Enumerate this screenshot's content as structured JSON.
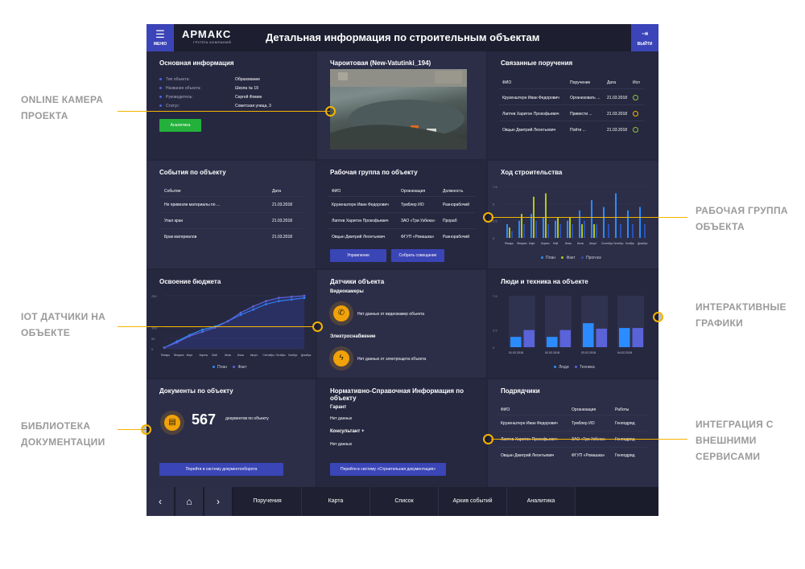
{
  "callouts": {
    "camera": [
      "ONLINE КАМЕРА",
      "ПРОЕКТА"
    ],
    "workgroup": [
      "РАБОЧАЯ ГРУППА",
      "ОБЪЕКТА"
    ],
    "iot": [
      "IOT ДАТЧИКИ НА",
      "ОБЪЕКТЕ"
    ],
    "charts": [
      "ИНТЕРАКТИВНЫЕ",
      "ГРАФИКИ"
    ],
    "docs": [
      "БИБЛИОТЕКА",
      "ДОКУМЕНТАЦИИ"
    ],
    "integration": [
      "ИНТЕГРАЦИЯ С",
      "ВНЕШНИМИ",
      "СЕРВИСАМИ"
    ]
  },
  "topbar": {
    "menu": "МЕНЮ",
    "logo": "АРМАКС",
    "logo_sub": "ГРУППА КОМПАНИЙ",
    "title": "Детальная информация по строительным объектам",
    "exit": "ВЫЙТИ"
  },
  "info": {
    "title": "Основная информация",
    "rows": [
      {
        "k": "Тип объекта:",
        "v": "Образование"
      },
      {
        "k": "Название объекта:",
        "v": "Школа № 19"
      },
      {
        "k": "Руководитель:",
        "v": "Сергей Фомин"
      },
      {
        "k": "Статус:",
        "v": "Советская улица, 3"
      }
    ],
    "button": "Аналитика"
  },
  "camera": {
    "title": "Чароитовая (New-Vatutinki_194)"
  },
  "orders": {
    "title": "Связанные поручения",
    "headers": [
      "ФИО",
      "Поручение",
      "Дата",
      "Исп"
    ],
    "rows": [
      [
        "Крузенштерн Иван Федорович",
        "Организовать ...",
        "21.03.2018"
      ],
      [
        "Лаптев Харитон Прокофьевич",
        "Привести ...",
        "21.03.2018"
      ],
      [
        "Овцын Дмитрий Леонтьевич",
        "Пойти ...",
        "21.03.2018"
      ]
    ]
  },
  "events": {
    "title": "События по объекту",
    "headers": [
      "Событие",
      "Дата"
    ],
    "rows": [
      [
        "Не привезли материалы по ...",
        "21.03.2018"
      ],
      [
        "Упал кран",
        "21.03.2018"
      ],
      [
        "Брак материалов",
        "21.03.2018"
      ]
    ]
  },
  "team": {
    "title": "Рабочая группа по объекту",
    "headers": [
      "ФИО",
      "Организация",
      "Должность"
    ],
    "rows": [
      [
        "Крузенштерн Иван Федорович",
        "Тумблер ИО",
        "Разнорабочий"
      ],
      [
        "Лаптев Харитон Прокофьевич",
        "ЗАО «Три Узбека»",
        "Прораб"
      ],
      [
        "Овцын Дмитрий Леонтьевич",
        "ФГУП «Ромашка»",
        "Разнорабочий"
      ]
    ],
    "btn1": "Управление",
    "btn2": "Собрать совещание"
  },
  "progress": {
    "title": "Ход строительства",
    "legend": [
      "План",
      "Факт",
      "Прогноз"
    ]
  },
  "budget": {
    "title": "Освоение бюджета",
    "legend": [
      "План",
      "Факт"
    ]
  },
  "sensors": {
    "title": "Датчики объекта",
    "s1": "Видеокамеры",
    "s1msg": "Нет данных от видеокамер объекта",
    "s2": "Электроснабжение",
    "s2msg": "Нет данных от электрощита объекта"
  },
  "people": {
    "title": "Люди и техника на объекте",
    "legend": [
      "Люди",
      "Техника"
    ]
  },
  "docs": {
    "title": "Документы по объекту",
    "count": "567",
    "label": "документов по объекту",
    "button": "Перейти в систему документооборота"
  },
  "ref": {
    "title": "Нормативно-Справочная Информация по объекту",
    "g": "Гарант",
    "gmsg": "Нет данных",
    "k": "Консультант +",
    "kmsg": "Нет данных",
    "button": "Перейти в систему «Строительная документация»"
  },
  "contractors": {
    "title": "Подрядчики",
    "headers": [
      "ФИО",
      "Организация",
      "Работы"
    ],
    "rows": [
      [
        "Крузенштерн Иван Федорович",
        "Тумблер ИО",
        "Генподряд"
      ],
      [
        "Лаптев Харитон Прокофьевич",
        "ЗАО «Три Узбека»",
        "Генподряд"
      ],
      [
        "Овцын Дмитрий Леонтьевич",
        "ФГУП «Ромашка»",
        "Генподряд"
      ]
    ]
  },
  "tabs": [
    "Поручения",
    "Карта",
    "Список",
    "Архив событий",
    "Аналитика"
  ],
  "chart_data": [
    {
      "type": "bar",
      "title": "Ход строительства",
      "categories": [
        "Январь",
        "Февраль",
        "Март",
        "Апрель",
        "Май",
        "Июнь",
        "Июль",
        "Август",
        "Сентябрь",
        "Октябрь",
        "Ноябрь",
        "Декабрь"
      ],
      "ylim": [
        0,
        7.5
      ],
      "yticks": [
        "7.5",
        "5",
        "2.5",
        "0"
      ],
      "series": [
        {
          "name": "План",
          "values": [
            2,
            2.5,
            3.5,
            3,
            2.5,
            2.5,
            4,
            5.5,
            4.5,
            6.5,
            4,
            4.5
          ]
        },
        {
          "name": "Факт",
          "values": [
            1.5,
            3.5,
            6,
            6.5,
            3,
            3,
            2,
            2,
            0,
            0,
            0,
            0
          ]
        },
        {
          "name": "Прогноз",
          "values": [
            1,
            2,
            2.5,
            2,
            2,
            2,
            2.5,
            2,
            2,
            2,
            2,
            2
          ]
        }
      ]
    },
    {
      "type": "line",
      "title": "Освоение бюджета",
      "categories": [
        "Январь",
        "Февраль",
        "Март",
        "Апрель",
        "Май",
        "Июнь",
        "Июль",
        "Август",
        "Сентябрь",
        "Октябрь",
        "Ноябрь",
        "Декабрь"
      ],
      "ylim": [
        0,
        250
      ],
      "yticks": [
        "250",
        "100",
        "50",
        "0"
      ],
      "series": [
        {
          "name": "План",
          "values": [
            5,
            35,
            65,
            90,
            105,
            130,
            160,
            185,
            210,
            225,
            232,
            240
          ]
        },
        {
          "name": "Факт",
          "values": [
            5,
            30,
            60,
            80,
            100,
            130,
            170,
            200,
            225,
            240,
            245,
            250
          ]
        }
      ]
    },
    {
      "type": "bar",
      "title": "Люди и техника на объекте",
      "categories": [
        "01.02.2018",
        "02.02.2018",
        "03.02.2018",
        "04.02.2018"
      ],
      "ylim": [
        0,
        7.5
      ],
      "yticks": [
        "7.5",
        "2.5",
        "0"
      ],
      "series": [
        {
          "name": "Люди",
          "values": [
            1.5,
            1.5,
            3.5,
            2.8
          ]
        },
        {
          "name": "Техника",
          "values": [
            2.5,
            2.5,
            2.7,
            2.8
          ]
        }
      ]
    }
  ]
}
